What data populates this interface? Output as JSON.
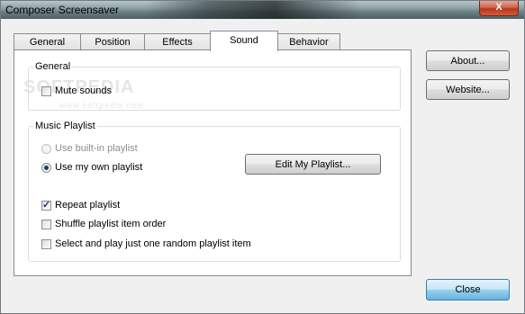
{
  "window": {
    "title": "Composer Screensaver",
    "close_label": "X"
  },
  "tabs": [
    {
      "label": "General",
      "active": false
    },
    {
      "label": "Position",
      "active": false
    },
    {
      "label": "Effects",
      "active": false
    },
    {
      "label": "Sound",
      "active": true
    },
    {
      "label": "Behavior",
      "active": false
    }
  ],
  "general_group": {
    "label": "General",
    "mute_sounds": {
      "label": "Mute sounds",
      "checked": false
    }
  },
  "playlist_group": {
    "label": "Music Playlist",
    "builtin": {
      "label": "Use built-in playlist",
      "selected": false,
      "enabled": false
    },
    "own": {
      "label": "Use my own playlist",
      "selected": true
    },
    "edit_button": "Edit My Playlist...",
    "repeat": {
      "label": "Repeat playlist",
      "checked": true
    },
    "shuffle": {
      "label": "Shuffle playlist item order",
      "checked": false
    },
    "random_one": {
      "label": "Select and play just one random playlist item",
      "checked": false
    }
  },
  "side_buttons": {
    "about": "About...",
    "website": "Website...",
    "close": "Close"
  },
  "watermark": {
    "logo": "SOFTPEDIA",
    "url": "www.softpedia.com"
  }
}
